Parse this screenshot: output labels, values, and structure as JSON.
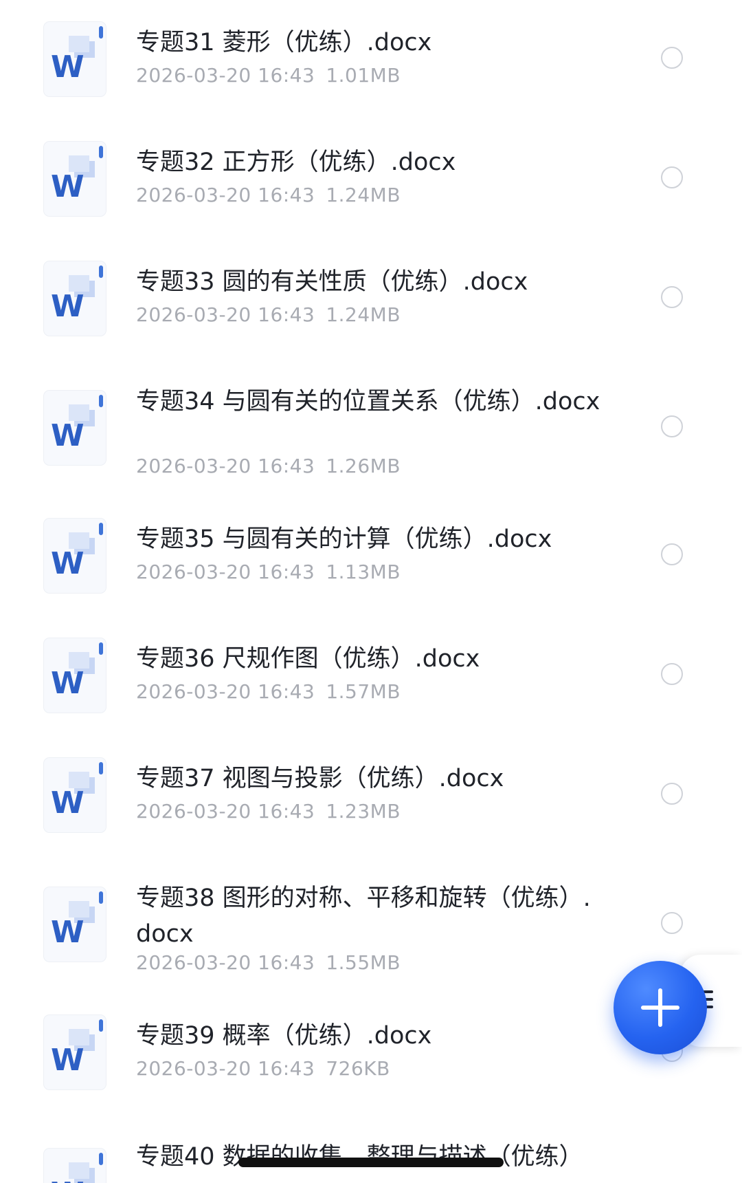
{
  "files": [
    {
      "name": "专题31 菱形（优练）.docx",
      "date": "2026-03-20 16:43",
      "size": "1.01MB",
      "icon": "word-doc-icon"
    },
    {
      "name": "专题32 正方形（优练）.docx",
      "date": "2026-03-20 16:43",
      "size": "1.24MB",
      "icon": "word-doc-icon"
    },
    {
      "name": "专题33 圆的有关性质（优练）.docx",
      "date": "2026-03-20 16:43",
      "size": "1.24MB",
      "icon": "word-doc-icon"
    },
    {
      "name": "专题34 与圆有关的位置关系（优练）.docx",
      "date": "2026-03-20 16:43",
      "size": "1.26MB",
      "icon": "word-doc-icon"
    },
    {
      "name": "专题35 与圆有关的计算（优练）.docx",
      "date": "2026-03-20 16:43",
      "size": "1.13MB",
      "icon": "word-doc-icon"
    },
    {
      "name": "专题36 尺规作图（优练）.docx",
      "date": "2026-03-20 16:43",
      "size": "1.57MB",
      "icon": "word-doc-icon"
    },
    {
      "name": "专题37 视图与投影（优练）.docx",
      "date": "2026-03-20 16:43",
      "size": "1.23MB",
      "icon": "word-doc-icon"
    },
    {
      "name": "专题38 图形的对称、平移和旋转（优练）.docx",
      "date": "2026-03-20 16:43",
      "size": "1.55MB",
      "icon": "word-doc-icon"
    },
    {
      "name": "专题39 概率（优练）.docx",
      "date": "2026-03-20 16:43",
      "size": "726KB",
      "icon": "word-doc-icon"
    },
    {
      "name": "专题40 数据的收集、整理与描述（优练）",
      "date": "",
      "size": "",
      "icon": "word-doc-icon"
    }
  ],
  "fab": {
    "icon": "plus-icon",
    "color": "#2563f0"
  },
  "side_menu": {
    "icon": "menu-icon"
  },
  "colors": {
    "file_name": "#20232a",
    "meta": "#a8abb2",
    "word_blue": "#2d5fc4",
    "check_border": "#cfd2d8"
  }
}
